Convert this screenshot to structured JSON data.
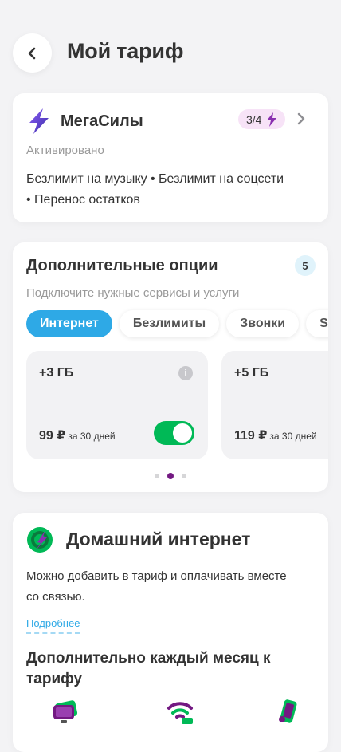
{
  "header": {
    "title": "Мой тариф"
  },
  "tariff": {
    "name": "МегаСилы",
    "level": "3/4",
    "status": "Активировано",
    "description": "Безлимит на музыку • Безлимит на соцсети • Перенос остатков"
  },
  "options": {
    "title": "Дополнительные опции",
    "count": "5",
    "subtitle": "Подключите нужные сервисы и услуги",
    "chips": [
      {
        "label": "Интернет",
        "active": true
      },
      {
        "label": "Безлимиты",
        "active": false
      },
      {
        "label": "Звонки",
        "active": false
      },
      {
        "label": "SMS",
        "active": false
      }
    ],
    "items": [
      {
        "volume": "+3 ГБ",
        "price": "99 ₽",
        "period": "за 30 дней",
        "enabled": true
      },
      {
        "volume": "+5 ГБ",
        "price": "119 ₽",
        "period": "за 30 дней"
      }
    ],
    "pager": {
      "total": 3,
      "active": 2
    }
  },
  "home_internet": {
    "title": "Домашний интернет",
    "text": "Можно добавить в тариф и оплачивать вместе со связью.",
    "more_link": "Подробнее",
    "subtitle": "Дополнительно каждый месяц к тарифу",
    "features": [
      "tv-icon",
      "wifi-router-icon",
      "phone-icon"
    ]
  },
  "colors": {
    "brand_purple": "#731982",
    "brand_green": "#00b956",
    "accent_blue": "#2ea9e6",
    "background": "#f3f3f5"
  }
}
